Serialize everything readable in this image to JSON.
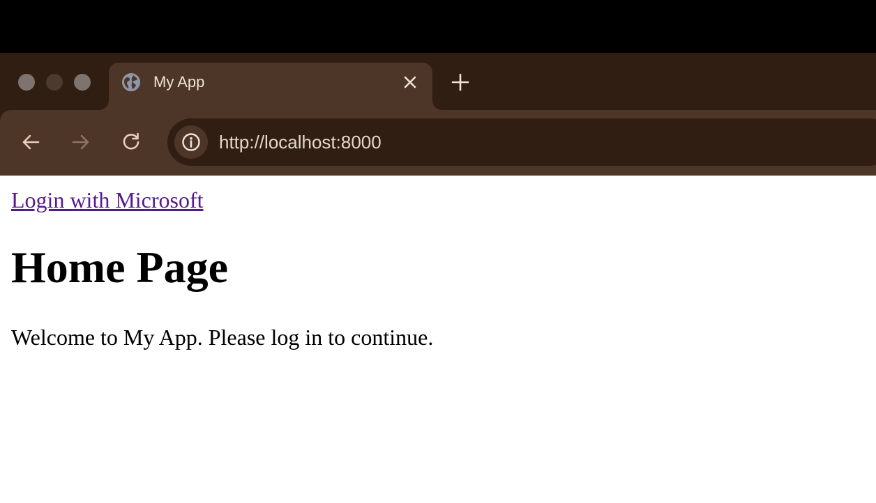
{
  "browser": {
    "window_controls": [
      "close",
      "minimize",
      "zoom"
    ],
    "tab": {
      "title": "My App",
      "favicon": "globe-icon",
      "close_icon": "close-icon"
    },
    "new_tab_icon": "plus-icon",
    "nav": {
      "back_icon": "arrow-left-icon",
      "forward_icon": "arrow-right-icon",
      "reload_icon": "reload-icon",
      "forward_enabled": false
    },
    "address_bar": {
      "site_info_icon": "info-icon",
      "url": "http://localhost:8000"
    },
    "colors": {
      "frame": "#301e12",
      "active_tab": "#4d3628",
      "toolbar": "#4d3628",
      "omnibox": "#301e12",
      "text": "#efe2d8"
    }
  },
  "page": {
    "login_link": "Login with Microsoft",
    "title": "Home Page",
    "welcome": "Welcome to My App. Please log in to continue.",
    "colors": {
      "link": "#551a8b",
      "text": "#000000",
      "background": "#ffffff"
    }
  }
}
